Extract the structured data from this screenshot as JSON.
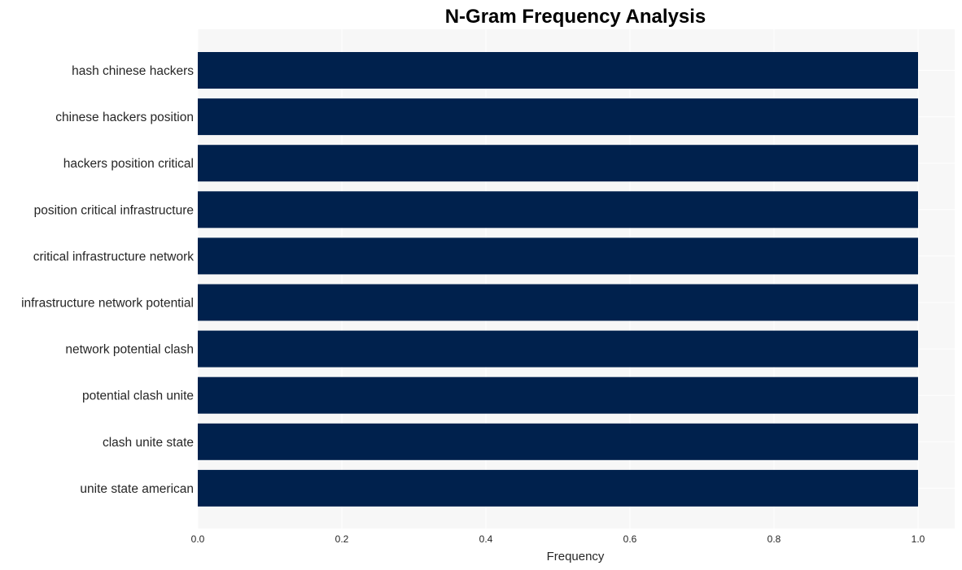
{
  "chart_data": {
    "type": "bar",
    "orientation": "horizontal",
    "title": "N-Gram Frequency Analysis",
    "xlabel": "Frequency",
    "ylabel": "",
    "xlim": [
      0,
      1.05
    ],
    "xticks": [
      "0.0",
      "0.2",
      "0.4",
      "0.6",
      "0.8",
      "1.0"
    ],
    "xtick_values": [
      0,
      0.2,
      0.4,
      0.6,
      0.8,
      1.0
    ],
    "grid": true,
    "bar_color": "#00214d",
    "background_color": "#f7f7f7",
    "categories": [
      "hash chinese hackers",
      "chinese hackers position",
      "hackers position critical",
      "position critical infrastructure",
      "critical infrastructure network",
      "infrastructure network potential",
      "network potential clash",
      "potential clash unite",
      "clash unite state",
      "unite state american"
    ],
    "values": [
      1,
      1,
      1,
      1,
      1,
      1,
      1,
      1,
      1,
      1
    ]
  }
}
